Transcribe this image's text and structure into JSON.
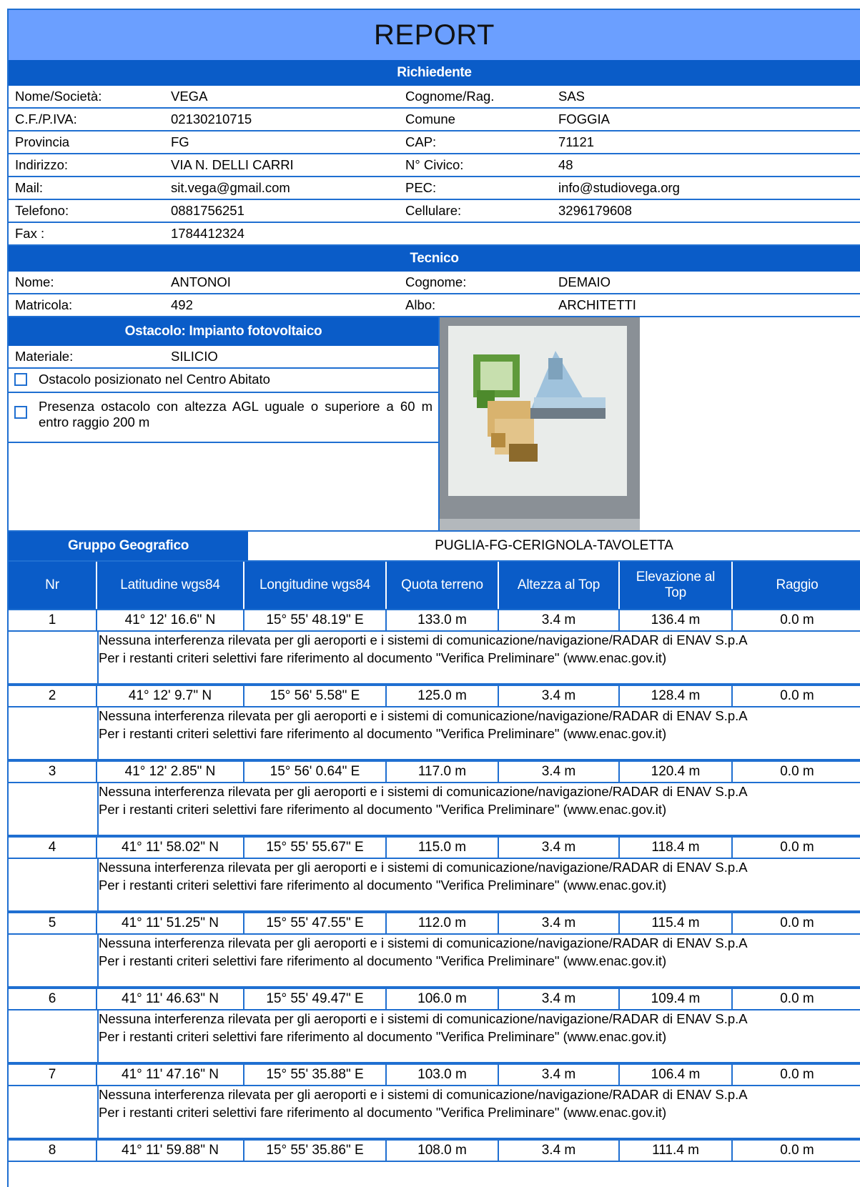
{
  "title": "REPORT",
  "richiedente": {
    "header": "Richiedente",
    "rows": [
      [
        "Nome/Società:",
        "VEGA",
        "Cognome/Rag.",
        "SAS"
      ],
      [
        "C.F./P.IVA:",
        "02130210715",
        "Comune",
        "FOGGIA"
      ],
      [
        "Provincia",
        "FG",
        "CAP:",
        "71121"
      ],
      [
        "Indirizzo:",
        "VIA N. DELLI CARRI",
        "N° Civico:",
        "48"
      ],
      [
        "Mail:",
        "sit.vega@gmail.com",
        "PEC:",
        "info@studiovega.org"
      ],
      [
        "Telefono:",
        "0881756251",
        "Cellulare:",
        "3296179608"
      ],
      [
        "Fax :",
        "1784412324",
        "",
        ""
      ]
    ]
  },
  "tecnico": {
    "header": "Tecnico",
    "rows": [
      [
        "Nome:",
        "ANTONOI",
        "Cognome:",
        "DEMAIO"
      ],
      [
        "Matricola:",
        "492",
        "Albo:",
        "ARCHITETTI"
      ]
    ]
  },
  "ostacolo": {
    "header": "Ostacolo: Impianto fotovoltaico",
    "material_label": "Materiale:",
    "material_value": "SILICIO",
    "check1": "Ostacolo posizionato nel Centro Abitato",
    "check2": "Presenza ostacolo con altezza AGL uguale o superiore a 60 m entro raggio 200 m"
  },
  "gruppo": {
    "label": "Gruppo Geografico",
    "value": "PUGLIA-FG-CERIGNOLA-TAVOLETTA"
  },
  "columns": [
    "Nr",
    "Latitudine wgs84",
    "Longitudine wgs84",
    "Quota terreno",
    "Altezza al Top",
    "Elevazione al Top",
    "Raggio"
  ],
  "note_line1": "Nessuna interferenza rilevata per gli aeroporti e i sistemi di comunicazione/navigazione/RADAR di ENAV S.p.A",
  "note_line2": "Per i restanti criteri selettivi fare riferimento al documento \"Verifica Preliminare\"  (www.enac.gov.it)",
  "points": [
    [
      "1",
      "41° 12' 16.6\" N",
      "15° 55' 48.19\" E",
      "133.0 m",
      "3.4 m",
      "136.4 m",
      "0.0 m"
    ],
    [
      "2",
      "41° 12' 9.7\" N",
      "15° 56' 5.58\" E",
      "125.0 m",
      "3.4 m",
      "128.4 m",
      "0.0 m"
    ],
    [
      "3",
      "41° 12' 2.85\" N",
      "15° 56' 0.64\" E",
      "117.0 m",
      "3.4 m",
      "120.4 m",
      "0.0 m"
    ],
    [
      "4",
      "41° 11' 58.02\" N",
      "15° 55' 55.67\" E",
      "115.0 m",
      "3.4 m",
      "118.4 m",
      "0.0 m"
    ],
    [
      "5",
      "41° 11' 51.25\" N",
      "15° 55' 47.55\" E",
      "112.0 m",
      "3.4 m",
      "115.4 m",
      "0.0 m"
    ],
    [
      "6",
      "41° 11' 46.63\" N",
      "15° 55' 49.47\" E",
      "106.0 m",
      "3.4 m",
      "109.4 m",
      "0.0 m"
    ],
    [
      "7",
      "41° 11' 47.16\" N",
      "15° 55' 35.88\" E",
      "103.0 m",
      "3.4 m",
      "106.4 m",
      "0.0 m"
    ],
    [
      "8",
      "41° 11' 59.88\" N",
      "15° 55' 35.86\" E",
      "108.0 m",
      "3.4 m",
      "111.4 m",
      "0.0 m"
    ]
  ]
}
